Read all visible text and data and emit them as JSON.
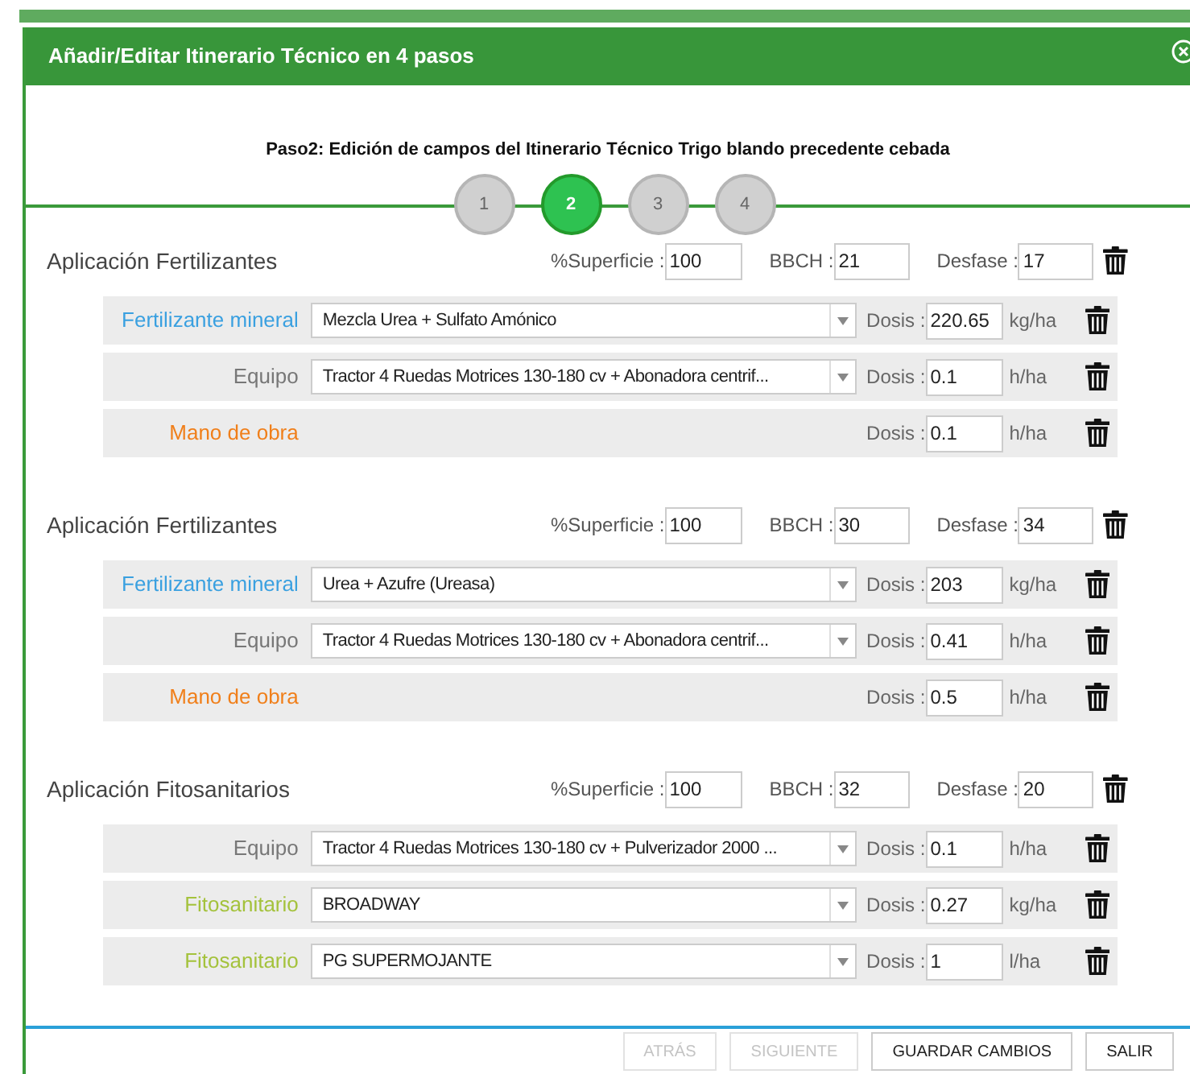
{
  "dialog": {
    "title": "Añadir/Editar Itinerario Técnico en 4 pasos"
  },
  "step_title": "Paso2: Edición de campos del Itinerario Técnico Trigo blando precedente cebada",
  "steps": [
    {
      "label": "1",
      "selected": false
    },
    {
      "label": "2",
      "selected": true
    },
    {
      "label": "3",
      "selected": false
    },
    {
      "label": "4",
      "selected": false
    }
  ],
  "sections": [
    {
      "title": "Aplicación Fertilizantes",
      "superficie_label": "%Superficie :",
      "superficie": "100",
      "bbch_label": "BBCH :",
      "bbch": "21",
      "desfase_label": "Desfase :",
      "desfase": "17",
      "rows": [
        {
          "kind": "fertilizante",
          "label": "Fertilizante mineral",
          "value": "Mezcla Urea + Sulfato Amónico",
          "dosis_label": "Dosis :",
          "dosis": "220.65",
          "unit": "kg/ha"
        },
        {
          "kind": "equipo",
          "label": "Equipo",
          "value": "Tractor 4 Ruedas Motrices 130-180 cv + Abonadora centrif...",
          "dosis_label": "Dosis :",
          "dosis": "0.1",
          "unit": "h/ha"
        },
        {
          "kind": "mano",
          "label": "Mano de obra",
          "dosis_label": "Dosis :",
          "dosis": "0.1",
          "unit": "h/ha"
        }
      ]
    },
    {
      "title": "Aplicación Fertilizantes",
      "superficie_label": "%Superficie :",
      "superficie": "100",
      "bbch_label": "BBCH :",
      "bbch": "30",
      "desfase_label": "Desfase :",
      "desfase": "34",
      "rows": [
        {
          "kind": "fertilizante",
          "label": "Fertilizante mineral",
          "value": "Urea + Azufre (Ureasa)",
          "dosis_label": "Dosis :",
          "dosis": "203",
          "unit": "kg/ha"
        },
        {
          "kind": "equipo",
          "label": "Equipo",
          "value": "Tractor 4 Ruedas Motrices 130-180 cv + Abonadora centrif...",
          "dosis_label": "Dosis :",
          "dosis": "0.41",
          "unit": "h/ha"
        },
        {
          "kind": "mano",
          "label": "Mano de obra",
          "dosis_label": "Dosis :",
          "dosis": "0.5",
          "unit": "h/ha"
        }
      ]
    },
    {
      "title": "Aplicación Fitosanitarios",
      "superficie_label": "%Superficie :",
      "superficie": "100",
      "bbch_label": "BBCH :",
      "bbch": "32",
      "desfase_label": "Desfase :",
      "desfase": "20",
      "rows": [
        {
          "kind": "equipo",
          "label": "Equipo",
          "value": "Tractor 4 Ruedas Motrices 130-180 cv + Pulverizador 2000 ...",
          "dosis_label": "Dosis :",
          "dosis": "0.1",
          "unit": "h/ha"
        },
        {
          "kind": "fitosanitario",
          "label": "Fitosanitario",
          "value": "BROADWAY",
          "dosis_label": "Dosis :",
          "dosis": "0.27",
          "unit": "kg/ha"
        },
        {
          "kind": "fitosanitario",
          "label": "Fitosanitario",
          "value": "PG SUPERMOJANTE",
          "dosis_label": "Dosis :",
          "dosis": "1",
          "unit": "l/ha"
        }
      ]
    }
  ],
  "buttons": [
    {
      "label": "ATRÁS",
      "disabled": true
    },
    {
      "label": "SIGUIENTE",
      "disabled": true
    },
    {
      "label": "GUARDAR CAMBIOS",
      "disabled": false
    },
    {
      "label": "SALIR",
      "disabled": false
    }
  ]
}
